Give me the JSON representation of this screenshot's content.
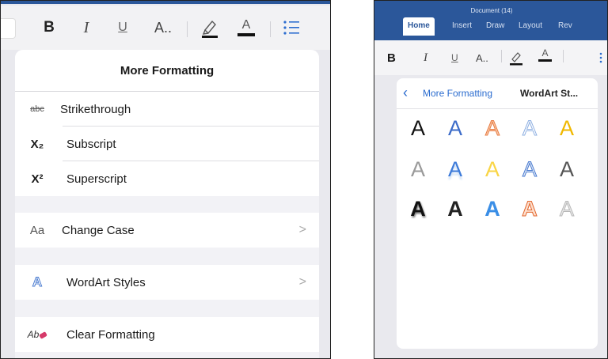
{
  "left": {
    "toolbar": {
      "bold": "B",
      "italic": "I",
      "underline": "U",
      "font_size": "A..",
      "font_color_letter": "A"
    },
    "sheet": {
      "title": "More Formatting",
      "effects": [
        {
          "icon_text": "abc",
          "label": "Strikethrough"
        },
        {
          "icon_text": "X₂",
          "label": "Subscript"
        },
        {
          "icon_text": "X²",
          "label": "Superscript"
        }
      ],
      "change_case": {
        "icon_text": "Aa",
        "label": "Change Case",
        "chevron": ">"
      },
      "wordart": {
        "icon_text": "A",
        "label": "WordArt Styles",
        "chevron": ">"
      },
      "clear": {
        "icon_text": "Ab",
        "label": "Clear Formatting"
      }
    }
  },
  "right": {
    "document_title": "Document (14)",
    "tabs": [
      "Home",
      "Insert",
      "Draw",
      "Layout",
      "Rev"
    ],
    "toolbar": {
      "bold": "B",
      "italic": "I",
      "underline": "U",
      "font_size": "A..",
      "font_color_letter": "A"
    },
    "nav": {
      "back_label": "More Formatting",
      "current_label": "WordArt St..."
    },
    "wordart_letter": "A",
    "wordart_styles": [
      {
        "style": "black-plain"
      },
      {
        "style": "blue-plain"
      },
      {
        "style": "orange-outline"
      },
      {
        "style": "light-blue-outline"
      },
      {
        "style": "gold-plain"
      },
      {
        "style": "gray-plain"
      },
      {
        "style": "blue-reflection"
      },
      {
        "style": "yellow-plain"
      },
      {
        "style": "blue-outline"
      },
      {
        "style": "dark-gray-plain"
      },
      {
        "style": "black-shadow"
      },
      {
        "style": "black-bold"
      },
      {
        "style": "blue-gradient"
      },
      {
        "style": "orange-outline"
      },
      {
        "style": "silver-plain"
      }
    ]
  },
  "colors": {
    "word_blue": "#2b579a",
    "link_blue": "#2b6ccf"
  }
}
